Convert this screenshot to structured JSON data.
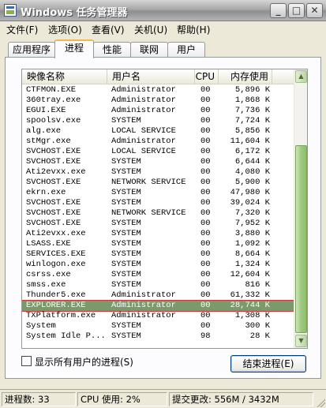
{
  "window": {
    "title": "Windows 任务管理器",
    "min_label": "_",
    "max_label": "□",
    "close_label": "✕"
  },
  "menu": [
    {
      "label": "文件(F)"
    },
    {
      "label": "选项(O)"
    },
    {
      "label": "查看(V)"
    },
    {
      "label": "关机(U)"
    },
    {
      "label": "帮助(H)"
    }
  ],
  "tabs": [
    {
      "label": "应用程序"
    },
    {
      "label": "进程",
      "active": true
    },
    {
      "label": "性能"
    },
    {
      "label": "联网"
    },
    {
      "label": "用户"
    }
  ],
  "table": {
    "headers": {
      "name": "映像名称",
      "user": "用户名",
      "cpu": "CPU",
      "mem": "内存使用"
    },
    "rows": [
      [
        "CTFMON.EXE",
        "Administrator",
        "00",
        "5,896 K"
      ],
      [
        "360tray.exe",
        "Administrator",
        "00",
        "1,868 K"
      ],
      [
        "EGUI.EXE",
        "Administrator",
        "00",
        "7,736 K"
      ],
      [
        "spoolsv.exe",
        "SYSTEM",
        "00",
        "7,724 K"
      ],
      [
        "alg.exe",
        "LOCAL SERVICE",
        "00",
        "5,856 K"
      ],
      [
        "stMgr.exe",
        "Administrator",
        "00",
        "11,604 K"
      ],
      [
        "SVCHOST.EXE",
        "LOCAL SERVICE",
        "00",
        "6,172 K"
      ],
      [
        "SVCHOST.EXE",
        "SYSTEM",
        "00",
        "6,644 K"
      ],
      [
        "Ati2evxx.exe",
        "SYSTEM",
        "00",
        "4,080 K"
      ],
      [
        "SVCHOST.EXE",
        "NETWORK SERVICE",
        "00",
        "5,900 K"
      ],
      [
        "ekrn.exe",
        "SYSTEM",
        "00",
        "47,980 K"
      ],
      [
        "SVCHOST.EXE",
        "SYSTEM",
        "00",
        "39,024 K"
      ],
      [
        "SVCHOST.EXE",
        "NETWORK SERVICE",
        "00",
        "7,320 K"
      ],
      [
        "SVCHOST.EXE",
        "SYSTEM",
        "00",
        "7,952 K"
      ],
      [
        "Ati2evxx.exe",
        "SYSTEM",
        "00",
        "3,880 K"
      ],
      [
        "LSASS.EXE",
        "SYSTEM",
        "00",
        "1,092 K"
      ],
      [
        "SERVICES.EXE",
        "SYSTEM",
        "00",
        "8,664 K"
      ],
      [
        "winlogon.exe",
        "SYSTEM",
        "00",
        "1,324 K"
      ],
      [
        "csrss.exe",
        "SYSTEM",
        "00",
        "12,604 K"
      ],
      [
        "smss.exe",
        "SYSTEM",
        "00",
        "816 K"
      ],
      [
        "Thunder5.exe",
        "Administrator",
        "00",
        "61,332 K"
      ],
      [
        "EXPLORER.EXE",
        "Administrator",
        "00",
        "28,744 K"
      ],
      [
        "TXPlatform.exe",
        "Administrator",
        "00",
        "1,308 K"
      ],
      [
        "System",
        "SYSTEM",
        "00",
        "300 K"
      ],
      [
        "System Idle P...",
        "SYSTEM",
        "98",
        "28 K"
      ]
    ],
    "selected_index": 21
  },
  "show_all_users": {
    "label": "显示所有用户的进程(S)",
    "checked": false
  },
  "end_process_button": "结束进程(E)",
  "status": {
    "processes": "进程数: 33",
    "cpu": "CPU 使用: 2%",
    "commit": "提交更改: 556M / 3432M"
  }
}
